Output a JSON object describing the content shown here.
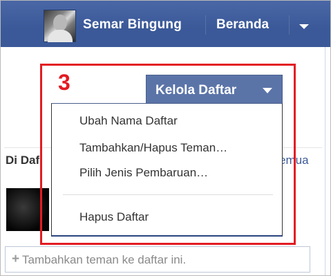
{
  "header": {
    "user_name": "Semar Bingung",
    "home_label": "Beranda"
  },
  "annotation": {
    "step_number": "3"
  },
  "list_manager": {
    "button_label": "Kelola Daftar",
    "menu_items": [
      "Ubah Nama Daftar",
      "Tambahkan/Hapus Teman…",
      "Pilih Jenis Pembaruan…",
      "Hapus Daftar"
    ]
  },
  "background": {
    "section_title": "Di Daf",
    "see_all_partial": "emua",
    "add_friend_placeholder": "Tambahkan teman ke daftar ini.",
    "plus_glyph": "+"
  },
  "colors": {
    "topbar": "#3b5998",
    "annotation_red": "#e31b23",
    "button_blue": "#5b74a8",
    "link_blue": "#3b5998"
  },
  "icons": [
    "profile-photo",
    "chevron-down-icon",
    "plus-icon"
  ]
}
